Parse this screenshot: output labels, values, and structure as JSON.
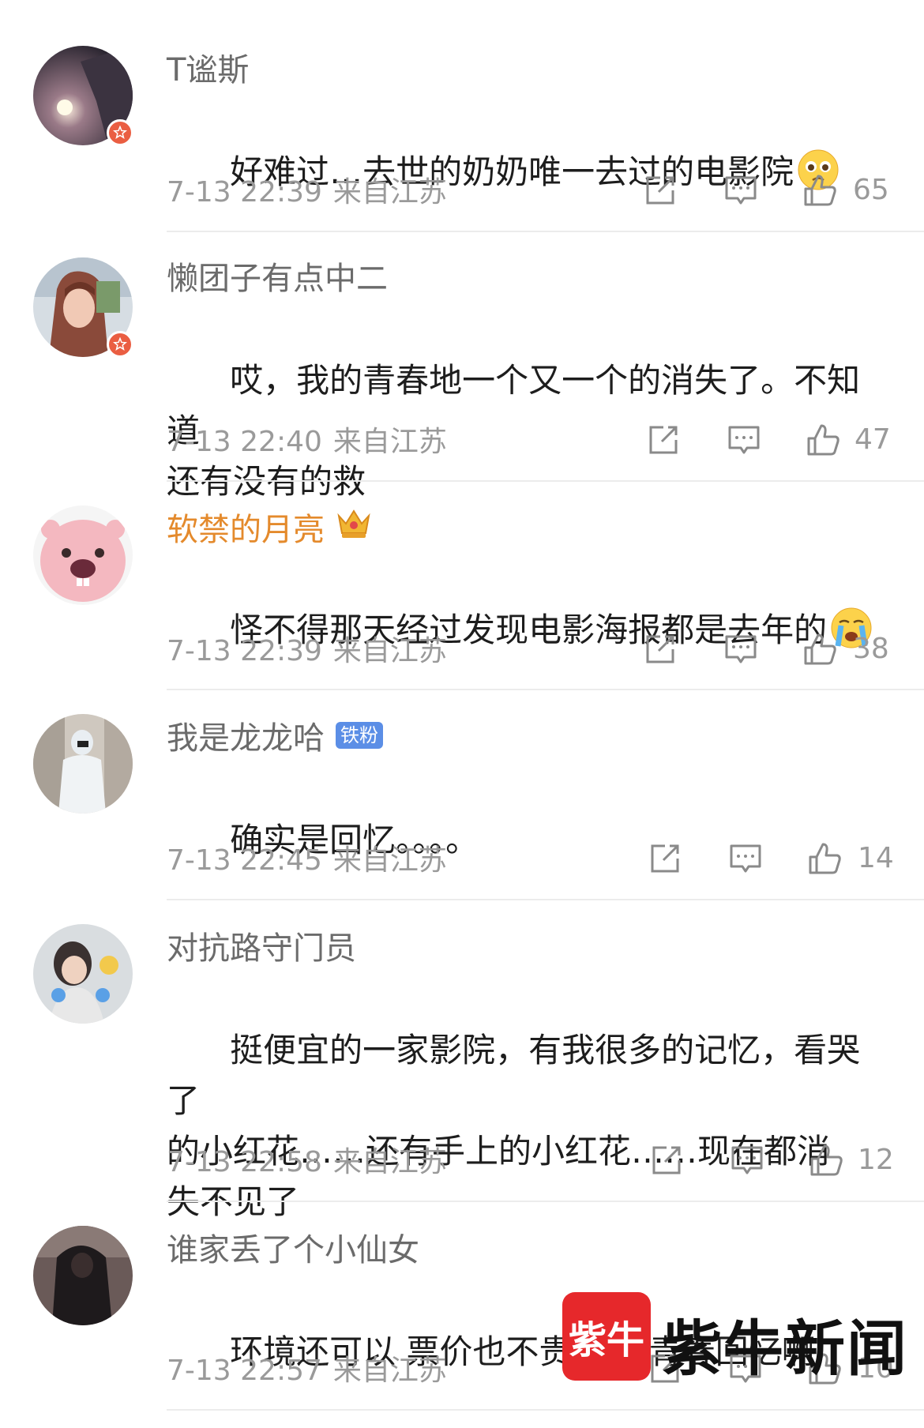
{
  "comments": [
    {
      "username": "T谧斯",
      "text": "好难过…去世的奶奶唯一去过的电影院",
      "emoji_icon": "pleading-face-icon",
      "time": "7-13 22:39",
      "location": "来自江苏",
      "likes": "65",
      "verified": true
    },
    {
      "username": "懒团子有点中二",
      "text": "哎，我的青春地一个又一个的消失了。不知道\n还有没有的救",
      "time": "7-13 22:40",
      "location": "来自江苏",
      "likes": "47",
      "verified": true
    },
    {
      "username": "软禁的月亮",
      "username_color": "#e48a2c",
      "badge_icon": "crown-icon",
      "text": "怪不得那天经过发现电影海报都是去年的",
      "emoji_icon": "crying-face-icon",
      "time": "7-13 22:39",
      "location": "来自江苏",
      "likes": "38"
    },
    {
      "username": "我是龙龙哈",
      "fan_badge": "铁粉",
      "text": "确实是回忆。。。。",
      "time": "7-13 22:45",
      "location": "来自江苏",
      "likes": "14"
    },
    {
      "username": "对抗路守门员",
      "text": "挺便宜的一家影院，有我很多的记忆，看哭了\n的小红花……还有手上的小红花……现在都消\n失不见了",
      "time": "7-13 22:58",
      "location": "来自江苏",
      "likes": "12"
    },
    {
      "username": "谁家丢了个小仙女",
      "text": "环境还可以 票价也不贵 都是青春回忆啊",
      "time": "7-13 22:57",
      "location": "来自江苏",
      "likes": "10"
    }
  ],
  "watermark": {
    "logo_text": "紫牛",
    "text": "紫牛新闻"
  },
  "colors": {
    "meta_gray": "#9a9a9a",
    "name_gray": "#6b6b6b",
    "gold_name": "#e48a2c",
    "verified_badge": "#ea5e42",
    "fan_badge": "#5b8ee6",
    "watermark_red": "#e6282b"
  },
  "action_icons": [
    "share-icon",
    "reply-icon",
    "like-icon"
  ]
}
